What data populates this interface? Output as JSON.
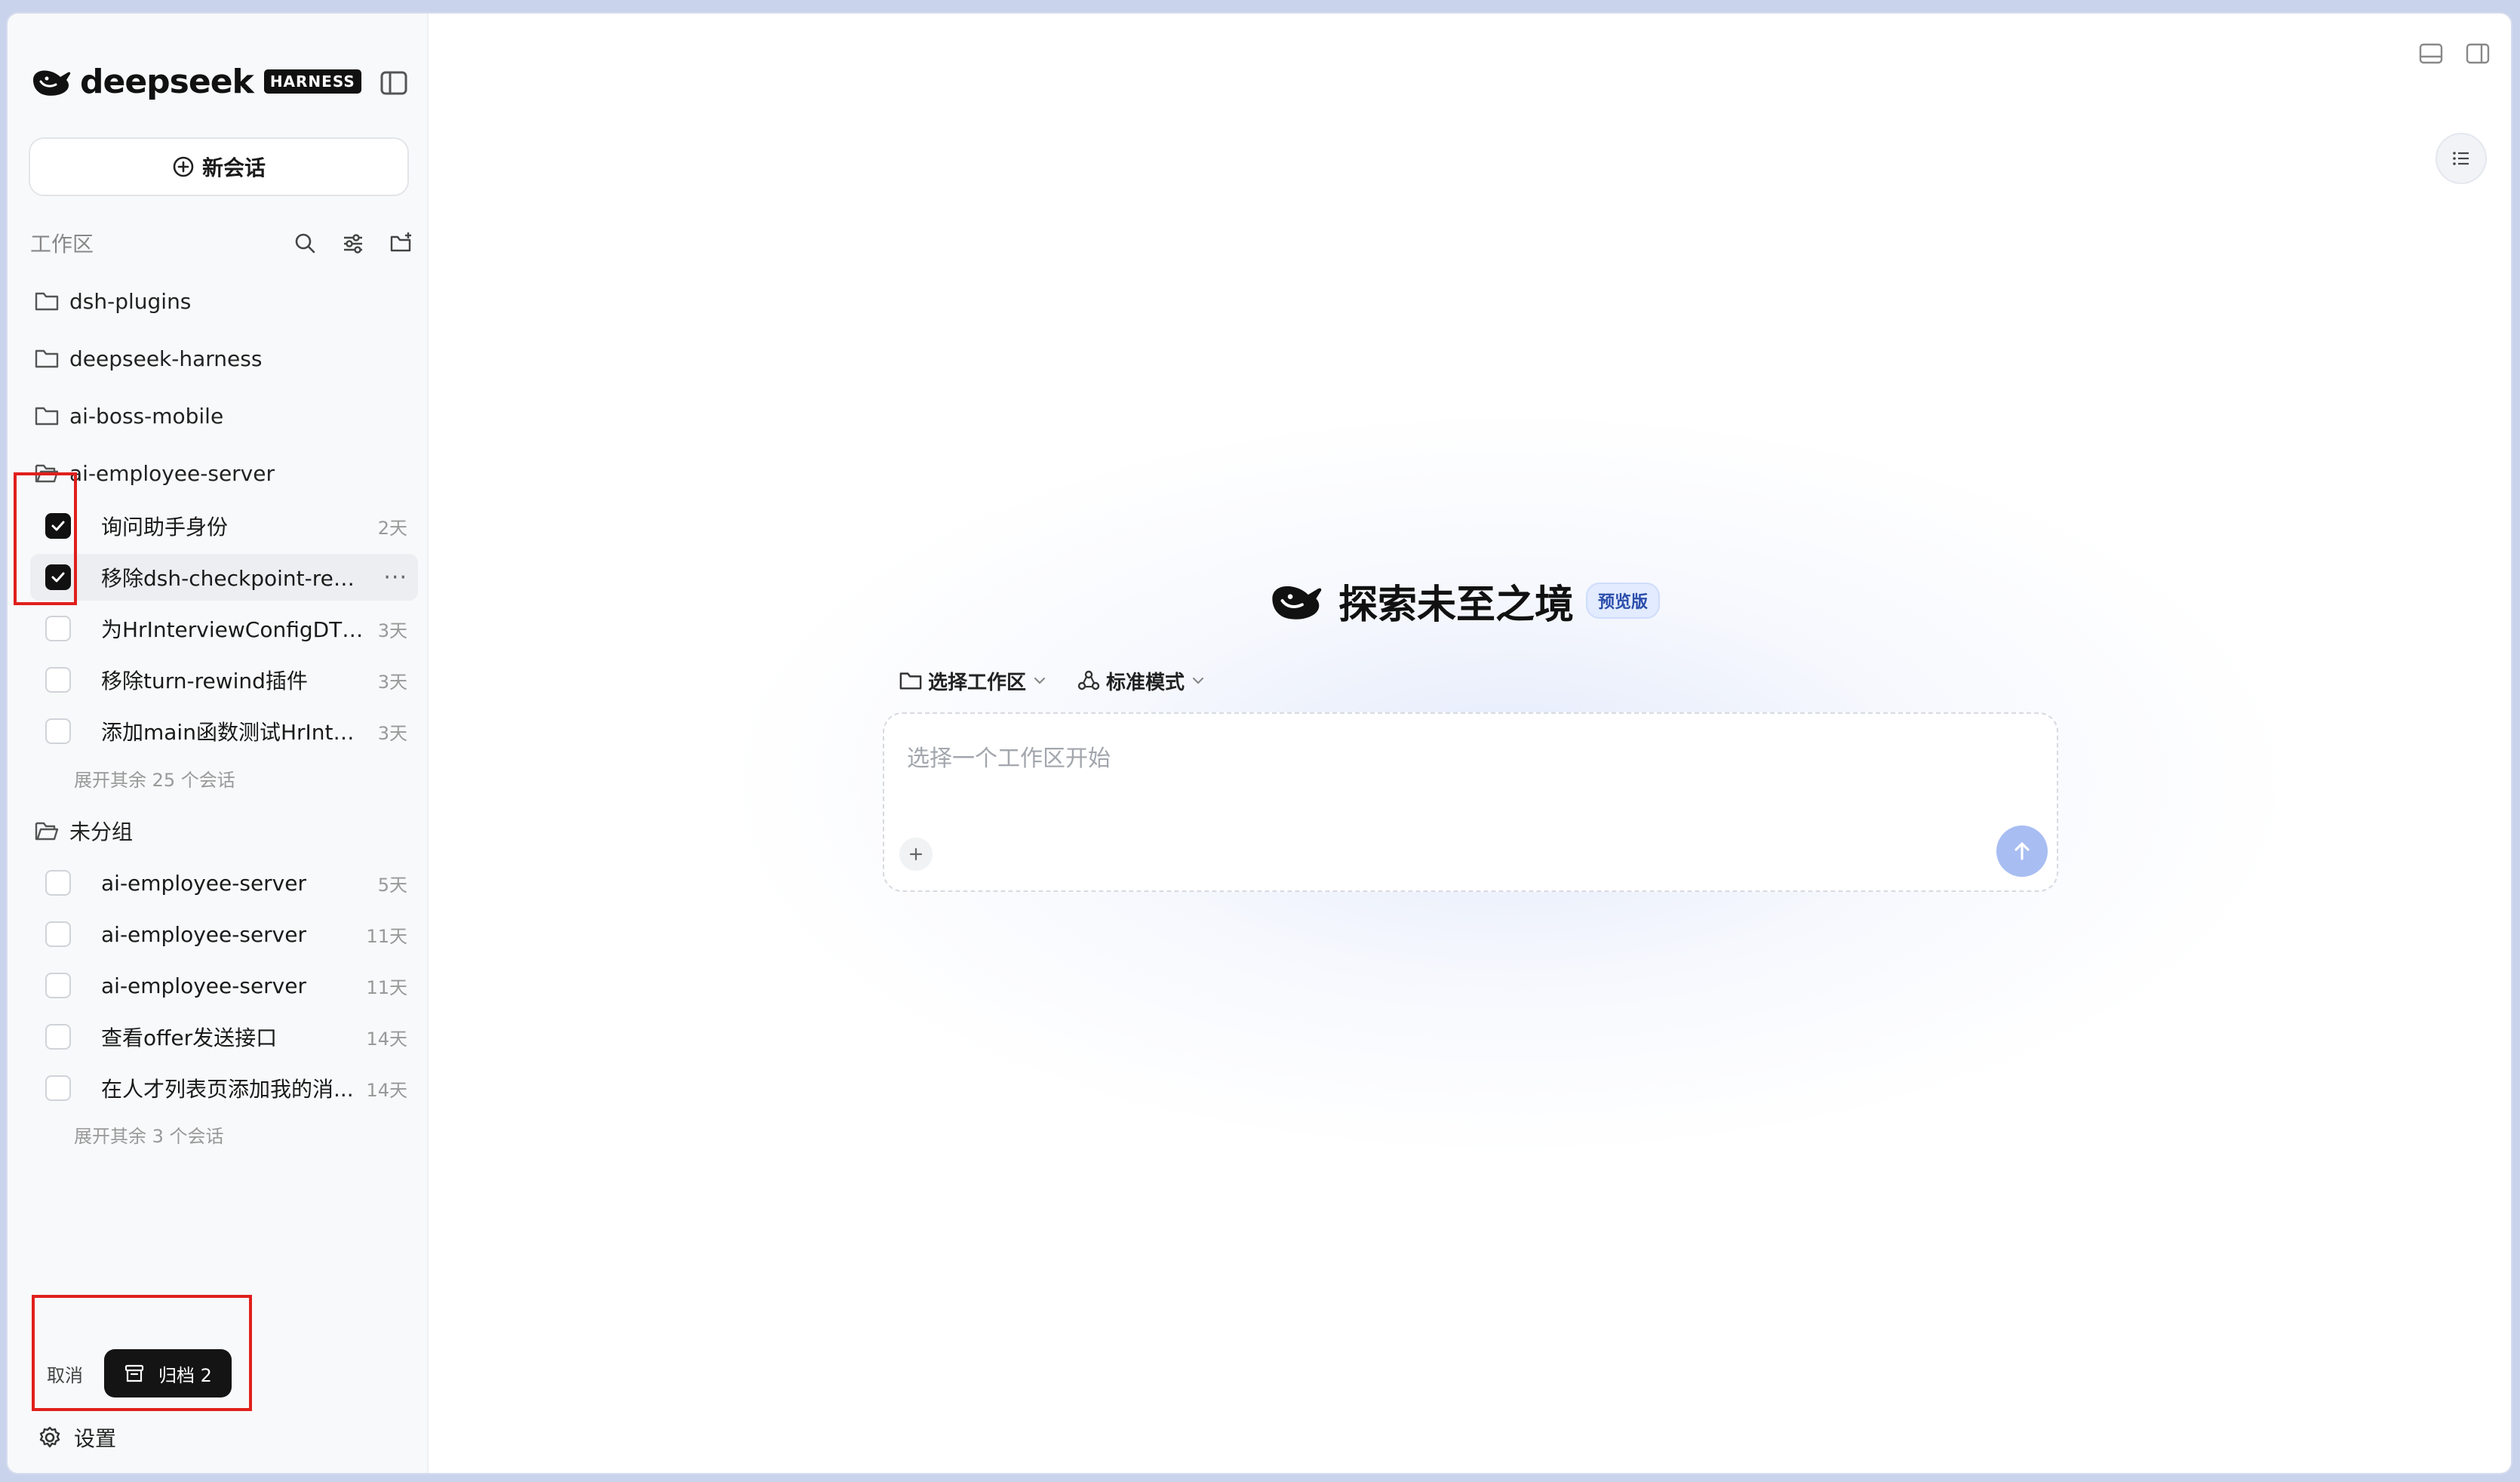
{
  "brand": {
    "name": "deepseek",
    "badge": "HARNESS"
  },
  "sidebar": {
    "new_chat_label": "新会话",
    "workspace_label": "工作区",
    "folders": [
      {
        "name": "dsh-plugins"
      },
      {
        "name": "deepseek-harness"
      },
      {
        "name": "ai-boss-mobile"
      },
      {
        "name": "ai-employee-server"
      }
    ],
    "ai_employee_server_conversations": [
      {
        "title": "询问助手身份",
        "age": "2天",
        "checked": true
      },
      {
        "title": "移除dsh-checkpoint-rewi...",
        "age": "",
        "checked": true,
        "more": "···"
      },
      {
        "title": "为HrInterviewConfigDTO...",
        "age": "3天",
        "checked": false
      },
      {
        "title": "移除turn-rewind插件",
        "age": "3天",
        "checked": false
      },
      {
        "title": "添加main函数测试HrInter...",
        "age": "3天",
        "checked": false
      }
    ],
    "expand_ai_employee_server": "展开其余 25 个会话",
    "ungrouped_label": "未分组",
    "ungrouped_conversations": [
      {
        "title": "ai-employee-server",
        "age": "5天",
        "checked": false
      },
      {
        "title": "ai-employee-server",
        "age": "11天",
        "checked": false
      },
      {
        "title": "ai-employee-server",
        "age": "11天",
        "checked": false
      },
      {
        "title": "查看offer发送接口",
        "age": "14天",
        "checked": false
      },
      {
        "title": "在人才列表页添加我的消...",
        "age": "14天",
        "checked": false
      }
    ],
    "expand_ungrouped": "展开其余 3 个会话",
    "cancel_label": "取消",
    "archive_label": "归档 2",
    "settings_label": "设置"
  },
  "main": {
    "hero_title": "探索未至之境",
    "hero_badge": "预览版",
    "workspace_selector": "选择工作区",
    "mode_selector": "标准模式",
    "composer_placeholder": "选择一个工作区开始"
  },
  "colors": {
    "accent_dark": "#141414",
    "send_button": "#a8bdf2",
    "preview_badge_bg": "#e2ebff",
    "annotation_red": "#e0201c"
  },
  "icons": [
    "whale-logo-icon",
    "sidebar-toggle-icon",
    "plus-circle-icon",
    "search-icon",
    "filter-icon",
    "new-folder-icon",
    "folder-icon",
    "folder-open-icon",
    "check-icon",
    "archive-icon",
    "gear-icon",
    "list-icon",
    "chevron-down-icon",
    "mode-icon",
    "plus-icon",
    "arrow-up-icon"
  ]
}
